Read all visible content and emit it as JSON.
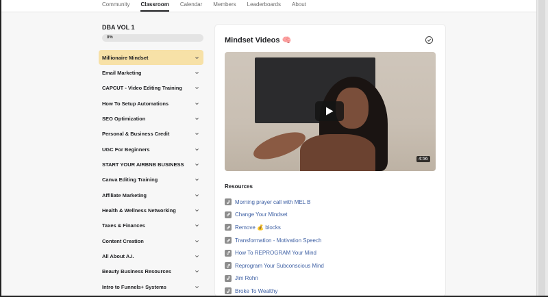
{
  "nav": {
    "tabs": [
      {
        "label": "Community",
        "active": false
      },
      {
        "label": "Classroom",
        "active": true
      },
      {
        "label": "Calendar",
        "active": false
      },
      {
        "label": "Members",
        "active": false
      },
      {
        "label": "Leaderboards",
        "active": false
      },
      {
        "label": "About",
        "active": false
      }
    ]
  },
  "sidebar": {
    "course_title": "DBA VOL 1",
    "progress": {
      "label": "0%",
      "percent": 0
    },
    "modules": [
      {
        "label": "Millionaire Mindset",
        "active": true
      },
      {
        "label": "Email Marketing",
        "active": false
      },
      {
        "label": "CAPCUT - Video Editing Training",
        "active": false
      },
      {
        "label": "How To Setup Automations",
        "active": false
      },
      {
        "label": "SEO Optimization",
        "active": false
      },
      {
        "label": "Personal & Business Credit",
        "active": false
      },
      {
        "label": "UGC For Beginners",
        "active": false
      },
      {
        "label": "START YOUR AIRBNB BUSINESS",
        "active": false
      },
      {
        "label": "Canva Editing Training",
        "active": false
      },
      {
        "label": "Affiliate Marketing",
        "active": false
      },
      {
        "label": "Health & Wellness Networking",
        "active": false
      },
      {
        "label": "Taxes & Finances",
        "active": false
      },
      {
        "label": "Content Creation",
        "active": false
      },
      {
        "label": "All About A.I.",
        "active": false
      },
      {
        "label": "Beauty Business Resources",
        "active": false
      },
      {
        "label": "Intro to Funnels+ Systems",
        "active": false
      }
    ]
  },
  "lesson": {
    "title": "Mindset Videos 🧠",
    "video": {
      "duration": "4:56"
    },
    "resources_heading": "Resources",
    "resources": [
      "Morning prayer call with MEL B",
      "Change Your Mindset",
      "Remove 💰 blocks",
      "Transformation - Motivation Speech",
      "How To REPROGRAM Your Mind",
      "Reprogram Your Subconscious Mind",
      "Jim Rohn",
      "Broke To Wealthy"
    ]
  },
  "colors": {
    "active_module_bg": "#f7e1a7",
    "link": "#3d5fa3",
    "page_bg": "#f7f7f7"
  }
}
